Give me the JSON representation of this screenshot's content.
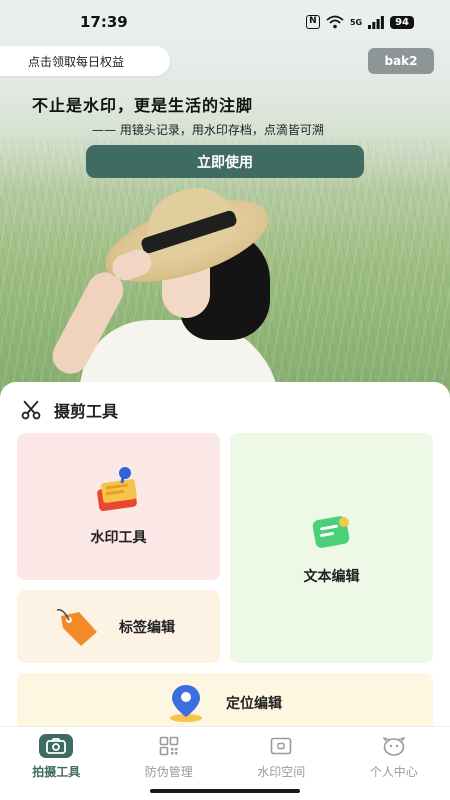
{
  "status_bar": {
    "time": "17:39",
    "network": "5G",
    "battery": "94"
  },
  "header": {
    "reward_label": "点击领取每日权益",
    "badge_label": "bak2",
    "slogan": "不止是水印，更是生活的注脚",
    "subslogan": "—— 用镜头记录，用水印存档，点滴皆可溯",
    "cta_label": "立即使用"
  },
  "section": {
    "title": "摄剪工具"
  },
  "tools": {
    "watermark": "水印工具",
    "text_edit": "文本编辑",
    "tag_edit": "标签编辑",
    "location_edit": "定位编辑"
  },
  "bottom_nav": {
    "items": [
      {
        "label": "拍摄工具",
        "icon": "camera-icon",
        "active": true
      },
      {
        "label": "防伪管理",
        "icon": "qr-code-icon",
        "active": false
      },
      {
        "label": "水印空间",
        "icon": "watermark-space-icon",
        "active": false
      },
      {
        "label": "个人中心",
        "icon": "profile-face-icon",
        "active": false
      }
    ]
  },
  "colors": {
    "primary": "#3f6b62",
    "card_pink": "#fde8e8",
    "card_green": "#edf8e6",
    "card_peach": "#fdf3e4",
    "card_yellow": "#fdf6e1"
  }
}
